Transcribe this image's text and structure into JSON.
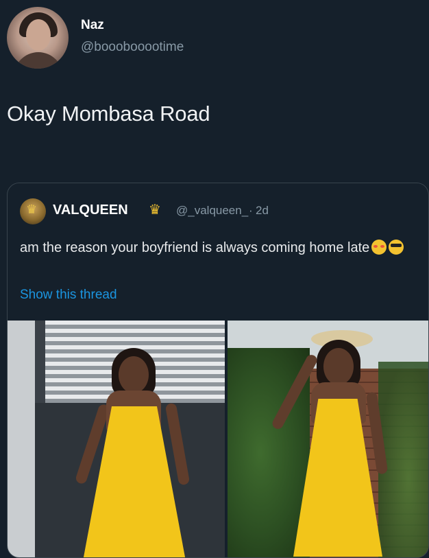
{
  "tweet": {
    "author_name": "Naz",
    "author_handle": "@booobooootime",
    "text": "Okay Mombasa Road"
  },
  "quoted_tweet": {
    "author_name": "VALQUEEN",
    "author_handle": "@_valqueen_",
    "separator": "·",
    "time": "2d",
    "text_main": "am the reason your boyfriend is always coming home late",
    "emojis": [
      "flushed-face-icon",
      "smiling-face-with-sunglasses-icon"
    ],
    "show_thread": "Show this thread",
    "photos": [
      {
        "name": "photo-woman-yellow-dress-gate"
      },
      {
        "name": "photo-woman-yellow-dress-hat"
      }
    ]
  },
  "colors": {
    "background": "#15202b",
    "secondary_text": "#8899a6",
    "link": "#1b95e0",
    "border": "#38444d"
  }
}
